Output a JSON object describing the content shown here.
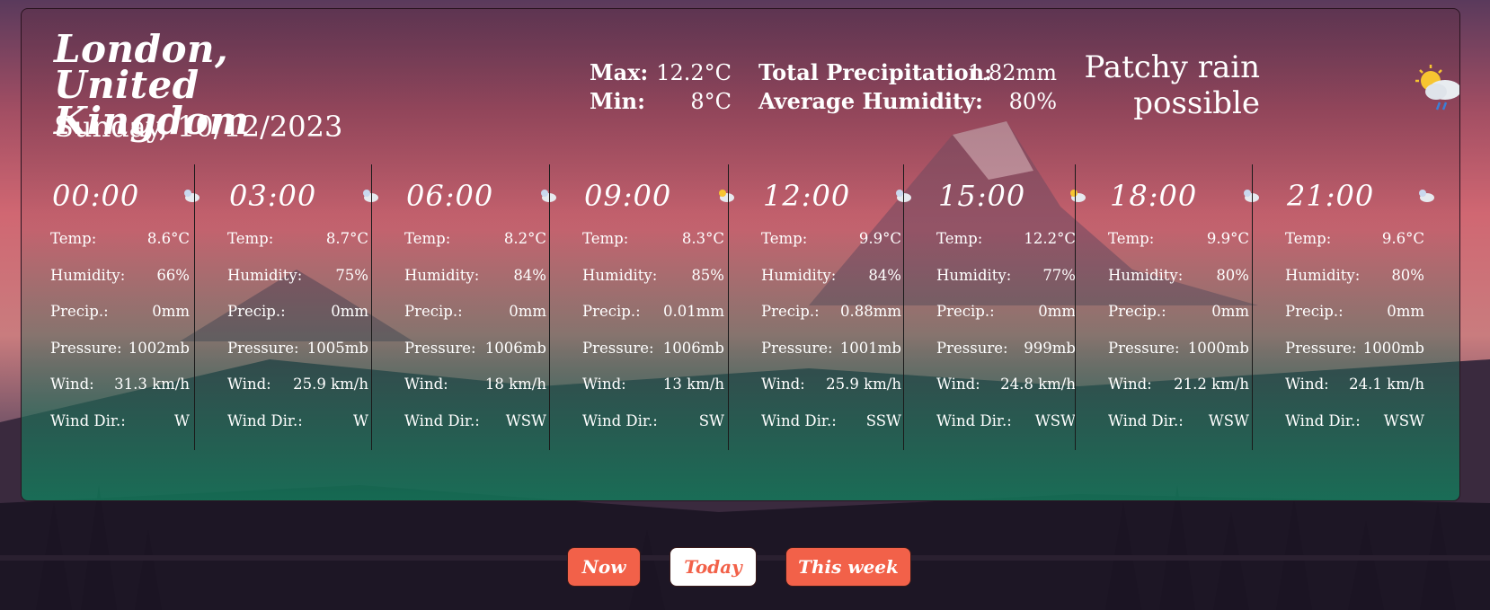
{
  "location": {
    "title": "London, United Kingdom",
    "date": "Sunday, 10/12/2023"
  },
  "summary": {
    "max_label": "Max:",
    "max_value": "12.2°C",
    "min_label": "Min:",
    "min_value": "8°C",
    "precip_label": "Total Precipitation:",
    "precip_value": "1.82mm",
    "humidity_label": "Average Humidity:",
    "humidity_value": "80%"
  },
  "condition": {
    "text": "Patchy rain possible",
    "icon": "patchy-rain-icon"
  },
  "labels": {
    "temp": "Temp:",
    "humidity": "Humidity:",
    "precip": "Precip.:",
    "pressure": "Pressure:",
    "wind": "Wind:",
    "wind_dir": "Wind Dir.:"
  },
  "hours": [
    {
      "time": "00:00",
      "icon": "night-drizzle-icon",
      "temp": "8.6°C",
      "humidity": "66%",
      "precip": "0mm",
      "pressure": "1002mb",
      "wind": "31.3 km/h",
      "wind_dir": "W"
    },
    {
      "time": "03:00",
      "icon": "night-cloudy-icon",
      "temp": "8.7°C",
      "humidity": "75%",
      "precip": "0mm",
      "pressure": "1005mb",
      "wind": "25.9 km/h",
      "wind_dir": "W"
    },
    {
      "time": "06:00",
      "icon": "night-cloudy-icon",
      "temp": "8.2°C",
      "humidity": "84%",
      "precip": "0mm",
      "pressure": "1006mb",
      "wind": "18 km/h",
      "wind_dir": "WSW"
    },
    {
      "time": "09:00",
      "icon": "partly-cloudy-icon",
      "temp": "8.3°C",
      "humidity": "85%",
      "precip": "0.01mm",
      "pressure": "1006mb",
      "wind": "13 km/h",
      "wind_dir": "SW"
    },
    {
      "time": "12:00",
      "icon": "cloudy-rain-icon",
      "temp": "9.9°C",
      "humidity": "84%",
      "precip": "0.88mm",
      "pressure": "1001mb",
      "wind": "25.9 km/h",
      "wind_dir": "SSW"
    },
    {
      "time": "15:00",
      "icon": "partly-cloudy-icon",
      "temp": "12.2°C",
      "humidity": "77%",
      "precip": "0mm",
      "pressure": "999mb",
      "wind": "24.8 km/h",
      "wind_dir": "WSW"
    },
    {
      "time": "18:00",
      "icon": "night-cloudy-icon",
      "temp": "9.9°C",
      "humidity": "80%",
      "precip": "0mm",
      "pressure": "1000mb",
      "wind": "21.2 km/h",
      "wind_dir": "WSW"
    },
    {
      "time": "21:00",
      "icon": "night-cloudy-icon",
      "temp": "9.6°C",
      "humidity": "80%",
      "precip": "0mm",
      "pressure": "1000mb",
      "wind": "24.1 km/h",
      "wind_dir": "WSW"
    }
  ],
  "buttons": {
    "now": "Now",
    "today": "Today",
    "week": "This week"
  },
  "colors": {
    "accent": "#f26149"
  }
}
